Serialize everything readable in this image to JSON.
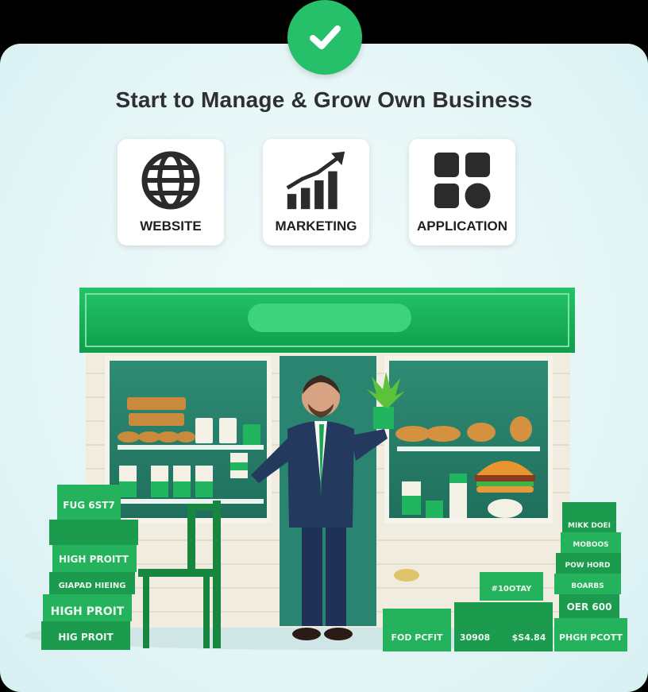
{
  "headline": "Start to Manage & Grow Own Business",
  "tiles": [
    {
      "label": "WEBSITE",
      "icon": "globe-icon"
    },
    {
      "label": "MARKETING",
      "icon": "growth-chart-icon"
    },
    {
      "label": "APPLICATION",
      "icon": "app-grid-icon"
    }
  ],
  "box_labels": {
    "left": [
      "FUG 6ST7",
      "HIGH PROITT",
      "GIAPAD HIEING",
      "HIGH PROIT",
      "HIG PROIT"
    ],
    "right": [
      "MIKK DOEI",
      "MOBOOS",
      "POW HORD",
      "BOARBS",
      "OER 600",
      "PHGH PCOTT",
      "FOD PCFIT",
      "30908",
      "$S4.84",
      "#10OTAY"
    ]
  },
  "colors": {
    "brand_green": "#1fb55e",
    "check_green": "#27c06a",
    "awning_green": "#16b65a",
    "suit_navy": "#23395e",
    "heading_text": "#2d2f33"
  },
  "icons": {
    "badge": "checkmark-icon"
  }
}
